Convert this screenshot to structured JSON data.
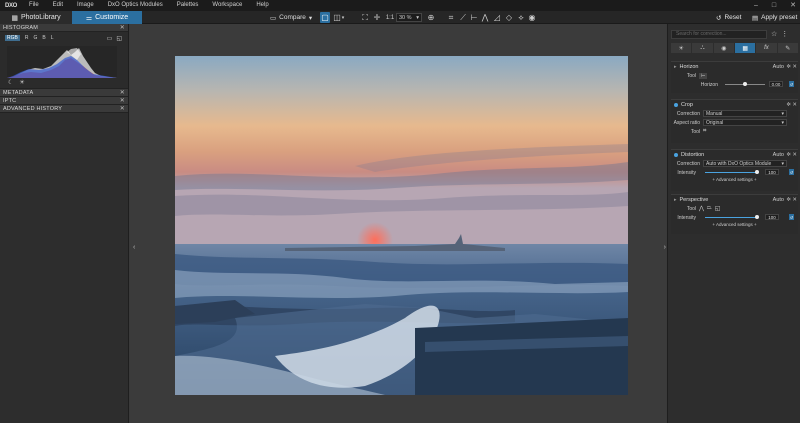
{
  "app": {
    "logo": "DXO"
  },
  "menu": [
    "File",
    "Edit",
    "Image",
    "DxO Optics Modules",
    "Palettes",
    "Workspace",
    "Help"
  ],
  "window_controls": [
    "–",
    "□",
    "✕"
  ],
  "toolbar": {
    "tab_photolibrary": "PhotoLibrary",
    "tab_customize": "Customize",
    "compare_label": "Compare",
    "zoom_one": "1:1",
    "zoom_value": "30 %",
    "reset_label": "Reset",
    "apply_preset_label": "Apply preset"
  },
  "left_panel": {
    "histogram": {
      "title": "HISTOGRAM",
      "channels": [
        "RGB",
        "R",
        "G",
        "B",
        "L"
      ],
      "active_channel": "RGB"
    },
    "sections": [
      "METADATA",
      "IPTC",
      "ADVANCED HISTORY"
    ]
  },
  "right_panel": {
    "search_placeholder": "Search for correction...",
    "horizon": {
      "title": "Horizon",
      "auto": "Auto",
      "tool_label": "Tool",
      "horizon_label": "Horizon",
      "value": "0.00",
      "level": 0.5
    },
    "crop": {
      "title": "Crop",
      "correction_label": "Correction",
      "correction_value": "Manual",
      "aspect_label": "Aspect ratio",
      "aspect_value": "Original",
      "tool_label": "Tool"
    },
    "distortion": {
      "title": "Distortion",
      "auto": "Auto",
      "correction_label": "Correction",
      "correction_value": "Auto with DxO Optics Module",
      "intensity_label": "Intensity",
      "intensity_value": "100",
      "level": 1.0,
      "advanced": "+ Advanced settings +"
    },
    "perspective": {
      "title": "Perspective",
      "auto": "Auto",
      "tool_label": "Tool",
      "intensity_label": "Intensity",
      "intensity_value": "100",
      "level": 1.0,
      "advanced": "+ Advanced settings +"
    }
  }
}
